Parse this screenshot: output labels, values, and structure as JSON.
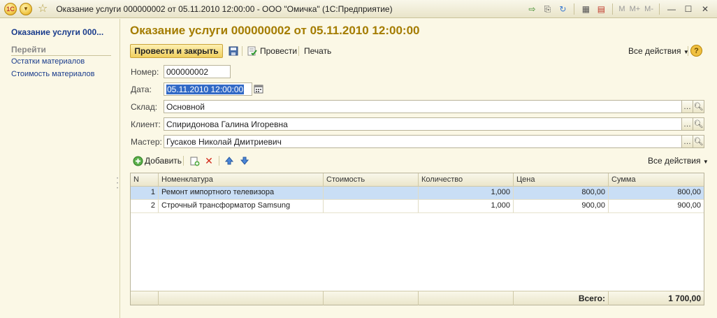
{
  "titlebar": {
    "title": "Оказание услуги 000000002 от 05.11.2010 12:00:00 - ООО \"Омичка\"  (1С:Предприятие)",
    "logo": "1С",
    "mem": [
      "M",
      "M+",
      "M-"
    ]
  },
  "nav": {
    "current": "Оказание услуги 000...",
    "section": "Перейти",
    "links": [
      "Остатки материалов",
      "Стоимость материалов"
    ]
  },
  "form": {
    "title": "Оказание услуги 000000002 от 05.11.2010 12:00:00",
    "toolbar": {
      "post_close": "Провести и закрыть",
      "post": "Провести",
      "print": "Печать",
      "all_actions": "Все действия",
      "help": "?"
    },
    "fields": {
      "number_label": "Номер:",
      "number": "000000002",
      "date_label": "Дата:",
      "date": "05.11.2010 12:00:00",
      "warehouse_label": "Склад:",
      "warehouse": "Основной",
      "client_label": "Клиент:",
      "client": "Спиридонова Галина Игоревна",
      "master_label": "Мастер:",
      "master": "Гусаков Николай Дмитриевич"
    },
    "table_toolbar": {
      "add": "Добавить",
      "all_actions": "Все действия"
    },
    "table": {
      "columns": [
        "N",
        "Номенклатура",
        "Стоимость",
        "Количество",
        "Цена",
        "Сумма"
      ],
      "rows": [
        {
          "n": "1",
          "item": "Ремонт импортного телевизора",
          "cost": "",
          "qty": "1,000",
          "price": "800,00",
          "sum": "800,00"
        },
        {
          "n": "2",
          "item": "Строчный трансформатор Samsung",
          "cost": "",
          "qty": "1,000",
          "price": "900,00",
          "sum": "900,00"
        }
      ],
      "total_label": "Всего:",
      "total": "1 700,00"
    }
  }
}
